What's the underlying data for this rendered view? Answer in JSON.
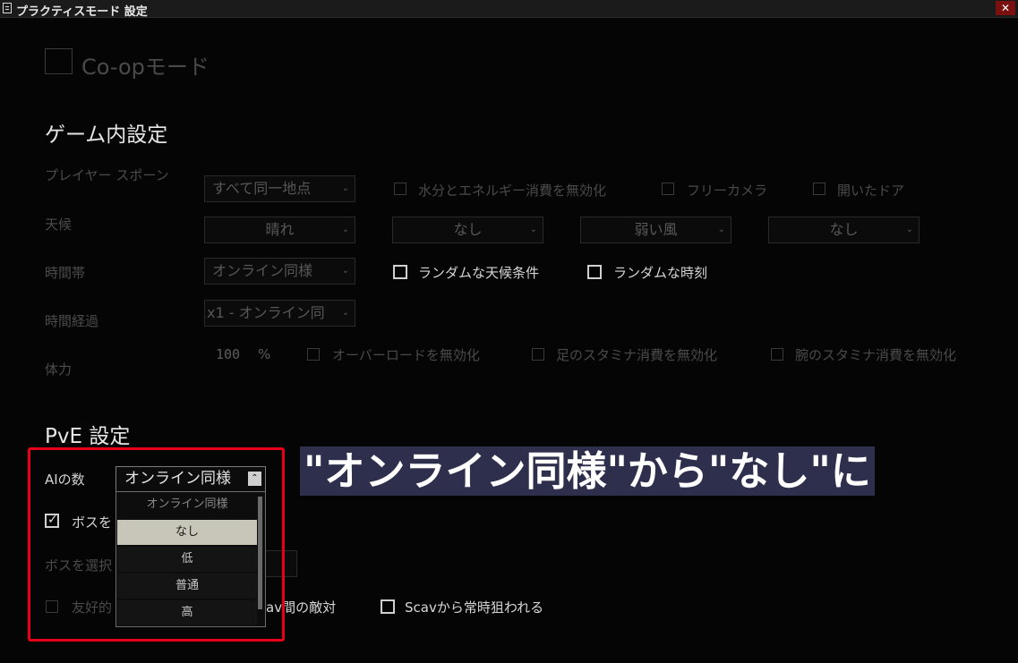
{
  "window": {
    "title": "プラクティスモード 設定",
    "close_label": "✕"
  },
  "coop": {
    "label": "Co-opモード"
  },
  "ingame": {
    "section_title": "ゲーム内設定",
    "player_spawn": {
      "label": "プレイヤー スポーン",
      "value": "すべて同一地点"
    },
    "disable_hydration": "水分とエネルギー消費を無効化",
    "free_camera": "フリーカメラ",
    "open_doors": "開いたドア",
    "weather": {
      "label": "天候",
      "clouds": "晴れ",
      "fog": "なし",
      "wind": "弱い風",
      "rain": "なし"
    },
    "time_of_day": {
      "label": "時間帯",
      "value": "オンライン同様"
    },
    "random_weather": "ランダムな天候条件",
    "random_time": "ランダムな時刻",
    "time_flow": {
      "label": "時間経過",
      "value": "x1 - オンライン同"
    },
    "stamina": {
      "label": "体力",
      "value": "100",
      "unit": "%"
    },
    "disable_overload": "オーバーロードを無効化",
    "disable_leg_stamina": "足のスタミナ消費を無効化",
    "disable_arm_stamina": "腕のスタミナ消費を無効化"
  },
  "pve": {
    "section_title": "PvE 設定",
    "ai_count": {
      "label": "AIの数",
      "value": "オンライン同様",
      "options_header": "オンライン同様",
      "options": [
        "なし",
        "低",
        "普通",
        "高"
      ]
    },
    "boss_enable_label": "ボスを",
    "boss_select_label": "ボスを選択",
    "friendly_label": "友好的",
    "scav_hostility": "av間の敵対",
    "scav_always_target": "Scavから常時狙われる"
  },
  "annotation": {
    "caption": "\"オンライン同様\"から\"なし\"に",
    "highlight_color": "#e8001a"
  }
}
